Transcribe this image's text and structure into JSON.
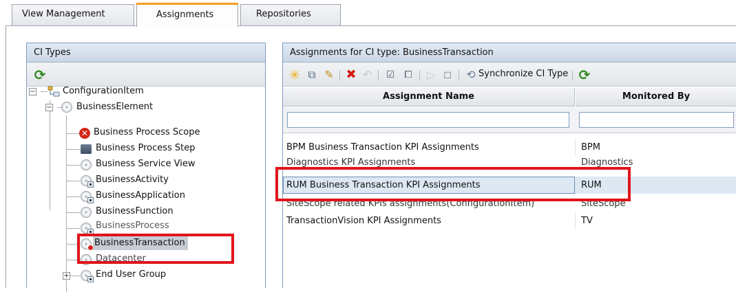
{
  "tabs": [
    {
      "label": "View Management"
    },
    {
      "label": "Assignments"
    },
    {
      "label": "Repositories"
    }
  ],
  "left_panel": {
    "title": "CI Types",
    "tree": [
      {
        "label": "ConfigurationItem"
      },
      {
        "label": "BusinessElement"
      },
      {
        "label": "Business Process Scope"
      },
      {
        "label": "Business Process Step"
      },
      {
        "label": "Business Service View"
      },
      {
        "label": "BusinessActivity"
      },
      {
        "label": "BusinessApplication"
      },
      {
        "label": "BusinessFunction"
      },
      {
        "label": "BusinessProcess"
      },
      {
        "label": "BusinessTransaction"
      },
      {
        "label": "Datacenter"
      },
      {
        "label": "End User Group"
      }
    ]
  },
  "right_panel": {
    "title": "Assignments for CI type: BusinessTransaction",
    "toolbar": {
      "sync_label": "Synchronize CI Type"
    },
    "columns": [
      "Assignment Name",
      "Monitored By"
    ],
    "rows": [
      {
        "name": "BPM Business Transaction KPI Assignments",
        "monitored_by": "BPM"
      },
      {
        "name": "Diagnostics KPI Assignments",
        "monitored_by": "Diagnostics"
      },
      {
        "name": "RUM Business Transaction KPI Assignments",
        "monitored_by": "RUM"
      },
      {
        "name": "SiteScope related KPIs assignments(ConfigurationItem)",
        "monitored_by": "SiteScope"
      },
      {
        "name": "TransactionVision KPI Assignments",
        "monitored_by": "TV"
      }
    ]
  },
  "colors": {
    "active_tab_accent": "#f29c1a",
    "highlight_box": "#e0141c",
    "panel_header": "#c9d6e6",
    "refresh_icon": "#2f8a1f"
  }
}
